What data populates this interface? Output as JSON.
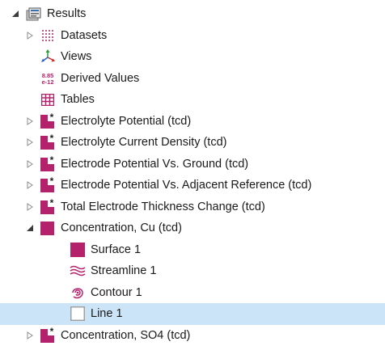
{
  "tree": {
    "root": {
      "label": "Results",
      "icon": "results-folder-icon",
      "expanded": true
    },
    "items": [
      {
        "label": "Datasets",
        "icon": "datasets-grid-icon",
        "expander": "collapsed"
      },
      {
        "label": "Views",
        "icon": "views-axes-icon",
        "expander": "none"
      },
      {
        "label": "Derived Values",
        "icon": "derived-values-icon",
        "expander": "none",
        "icon_text_top": "8.85",
        "icon_text_bottom": "e-12"
      },
      {
        "label": "Tables",
        "icon": "table-icon",
        "expander": "none"
      },
      {
        "label": "Electrolyte Potential (tcd)",
        "icon": "plot-group-icon",
        "expander": "collapsed"
      },
      {
        "label": "Electrolyte Current Density (tcd)",
        "icon": "plot-group-icon",
        "expander": "collapsed"
      },
      {
        "label": "Electrode Potential Vs. Ground (tcd)",
        "icon": "plot-group-icon",
        "expander": "collapsed"
      },
      {
        "label": "Electrode Potential Vs. Adjacent Reference (tcd)",
        "icon": "plot-group-icon",
        "expander": "collapsed"
      },
      {
        "label": "Total Electrode Thickness Change (tcd)",
        "icon": "plot-group-icon",
        "expander": "collapsed"
      },
      {
        "label": "Concentration, Cu (tcd)",
        "icon": "plot-group-icon-plain",
        "expander": "expanded"
      },
      {
        "label": "Concentration, SO4 (tcd)",
        "icon": "plot-group-icon",
        "expander": "collapsed"
      }
    ],
    "children": [
      {
        "label": "Surface 1",
        "icon": "surface-icon"
      },
      {
        "label": "Streamline 1",
        "icon": "streamline-icon"
      },
      {
        "label": "Contour 1",
        "icon": "contour-icon"
      },
      {
        "label": "Line 1",
        "icon": "line-icon",
        "selected": true
      }
    ]
  },
  "colors": {
    "accent": "#b3226b",
    "selection": "#cce4f7",
    "arrow": "#8a8a8a"
  }
}
